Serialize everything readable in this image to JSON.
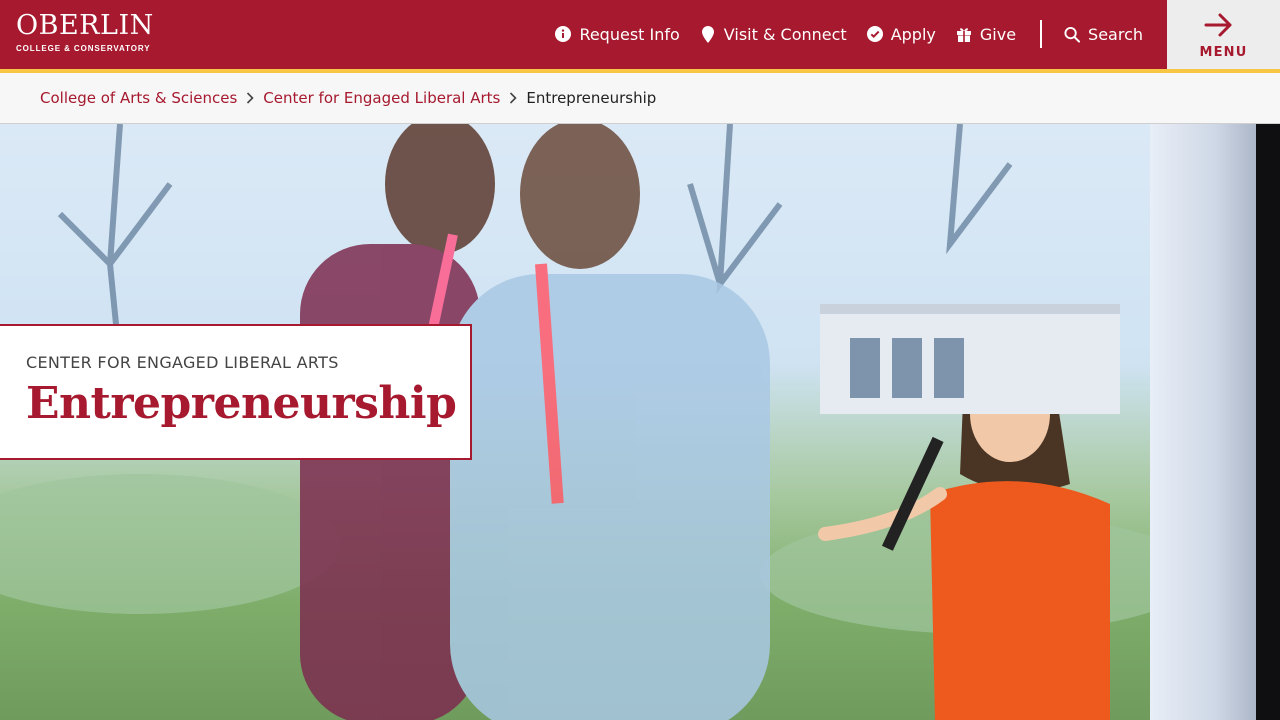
{
  "logo": {
    "name": "OBERLIN",
    "subtitle": "COLLEGE & CONSERVATORY"
  },
  "nav": {
    "items": [
      {
        "label": "Request Info",
        "icon": "info-circle-icon"
      },
      {
        "label": "Visit & Connect",
        "icon": "map-pin-icon"
      },
      {
        "label": "Apply",
        "icon": "check-circle-icon"
      },
      {
        "label": "Give",
        "icon": "gift-icon"
      }
    ],
    "search_label": "Search",
    "menu_label": "MENU"
  },
  "breadcrumb": {
    "items": [
      {
        "label": "College of Arts & Sciences"
      },
      {
        "label": "Center for Engaged Liberal Arts"
      }
    ],
    "current": "Entrepreneurship"
  },
  "hero": {
    "eyebrow": "CENTER FOR ENGAGED LIBERAL ARTS",
    "title": "Entrepreneurship"
  },
  "colors": {
    "brand_red": "#a6192e",
    "accent_gold": "#f6c644",
    "breadcrumb_bg": "#f7f7f7",
    "menu_bg": "#ededed"
  }
}
